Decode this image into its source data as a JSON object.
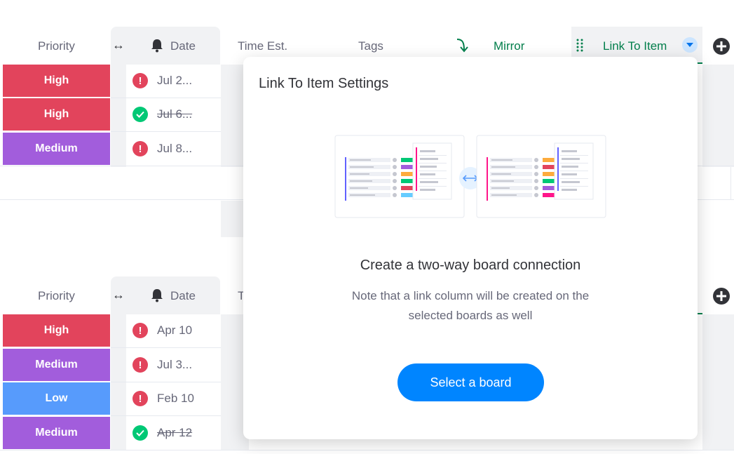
{
  "header": {
    "priority": "Priority",
    "date": "Date",
    "time_est": "Time Est.",
    "tags": "Tags",
    "mirror": "Mirror",
    "link_to_item": "Link To Item"
  },
  "group1": {
    "rows": [
      {
        "priority": "High",
        "priority_color": "#e2445c",
        "date": "Jul 2...",
        "status": "overdue",
        "done": false
      },
      {
        "priority": "High",
        "priority_color": "#e2445c",
        "date": "Jul 6...",
        "status": "done",
        "done": true
      },
      {
        "priority": "Medium",
        "priority_color": "#a25ddc",
        "date": "Jul 8...",
        "status": "overdue",
        "done": false
      }
    ]
  },
  "group2": {
    "time_est_partial": "T",
    "rows": [
      {
        "priority": "High",
        "priority_color": "#e2445c",
        "date": "Apr 10",
        "status": "overdue",
        "done": false
      },
      {
        "priority": "Medium",
        "priority_color": "#a25ddc",
        "date": "Jul 3...",
        "status": "overdue",
        "done": false
      },
      {
        "priority": "Low",
        "priority_color": "#579bfc",
        "date": "Feb 10",
        "status": "overdue",
        "done": false
      },
      {
        "priority": "Medium",
        "priority_color": "#a25ddc",
        "date": "Apr 12",
        "status": "done",
        "done": true
      }
    ]
  },
  "modal": {
    "title": "Link To Item Settings",
    "heading": "Create a two-way board connection",
    "note_line1": "Note that a link column will be created on the",
    "note_line2": "selected boards as well",
    "button": "Select a board"
  },
  "icons": {
    "resize": "resize-arrows-icon",
    "bell": "bell-icon",
    "mirror": "mirror-arrow-icon",
    "drag": "drag-handle-icon",
    "dropdown": "chevron-down-icon",
    "add": "plus-icon",
    "overdue": "exclamation-icon",
    "done": "check-icon"
  },
  "colors": {
    "high": "#e2445c",
    "medium": "#a25ddc",
    "low": "#579bfc",
    "overdue": "#e2445c",
    "done": "#00c875",
    "accent": "#0085ff",
    "mirror_green": "#037f4c"
  }
}
